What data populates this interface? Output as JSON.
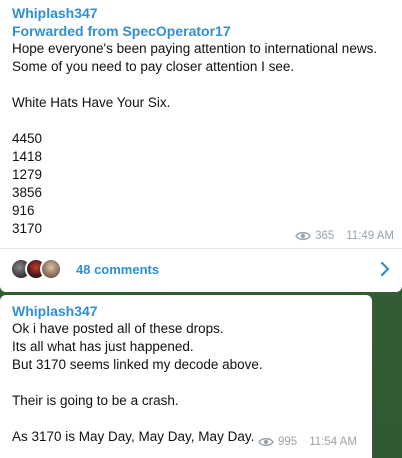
{
  "post1": {
    "sender": "Whiplash347",
    "forwarded": "Forwarded from SpecOperator17",
    "lines": [
      "Hope everyone's been paying attention to international news.",
      "Some of you need to pay closer attention I see.",
      "",
      "White Hats Have Your Six.",
      "",
      "4450",
      "1418",
      "1279",
      "3856",
      "916",
      "3170"
    ],
    "views": "365",
    "time": "11:49 AM",
    "comments_label": "48 comments"
  },
  "post2": {
    "sender": "Whiplash347",
    "lines": [
      "Ok  i have posted all of these drops.",
      "Its all what has just happened.",
      "But 3170 seems linked my decode above.",
      "",
      "Their is going to be a crash.",
      "",
      "As 3170 is May Day, May Day, May Day."
    ],
    "views": "995",
    "time": "11:54 AM"
  },
  "icons": {
    "views": "eye-icon",
    "comments_arrow": "chevron-right-icon"
  },
  "colors": {
    "accent": "#2f8fd0",
    "meta": "#9aa3ab",
    "background": "#3f6b3a"
  }
}
